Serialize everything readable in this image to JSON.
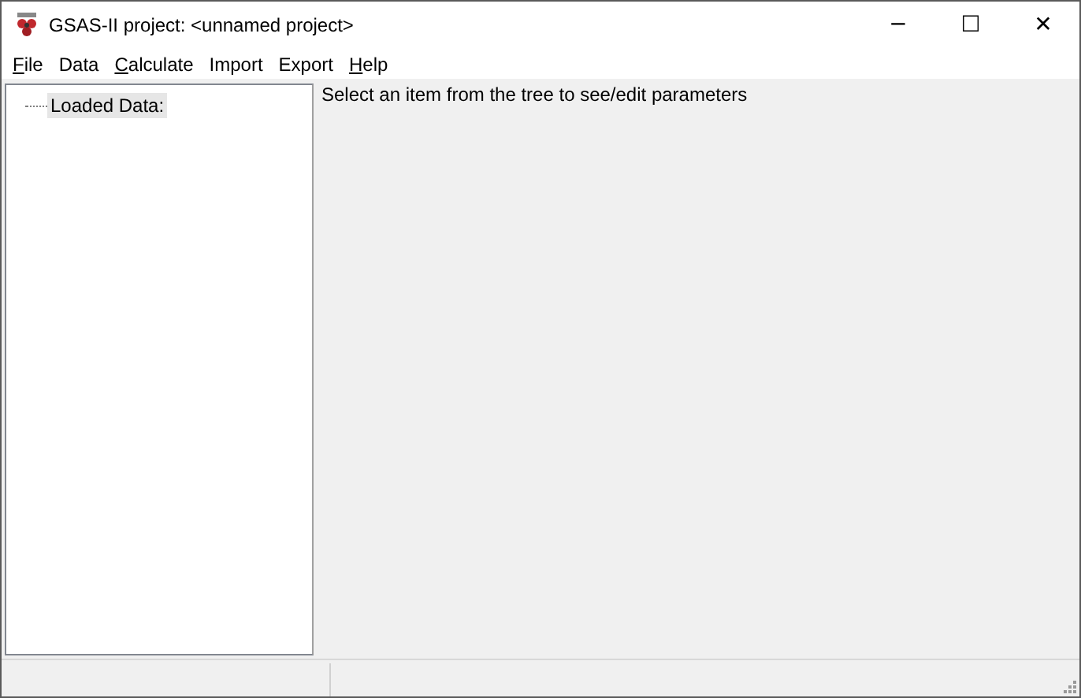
{
  "window": {
    "title": "GSAS-II project: <unnamed project>",
    "controls": [
      "─",
      "☐",
      "✕"
    ]
  },
  "menu": [
    {
      "label": "File",
      "mnemonic": true
    },
    {
      "label": "Data",
      "mnemonic": false
    },
    {
      "label": "Calculate",
      "mnemonic": true
    },
    {
      "label": "Import",
      "mnemonic": false
    },
    {
      "label": "Export",
      "mnemonic": false
    },
    {
      "label": "Help",
      "mnemonic": true
    }
  ],
  "tree": {
    "items": [
      {
        "label": "Loaded Data:",
        "selected": true
      }
    ]
  },
  "detail": {
    "message": "Select an item from the tree to see/edit parameters"
  }
}
